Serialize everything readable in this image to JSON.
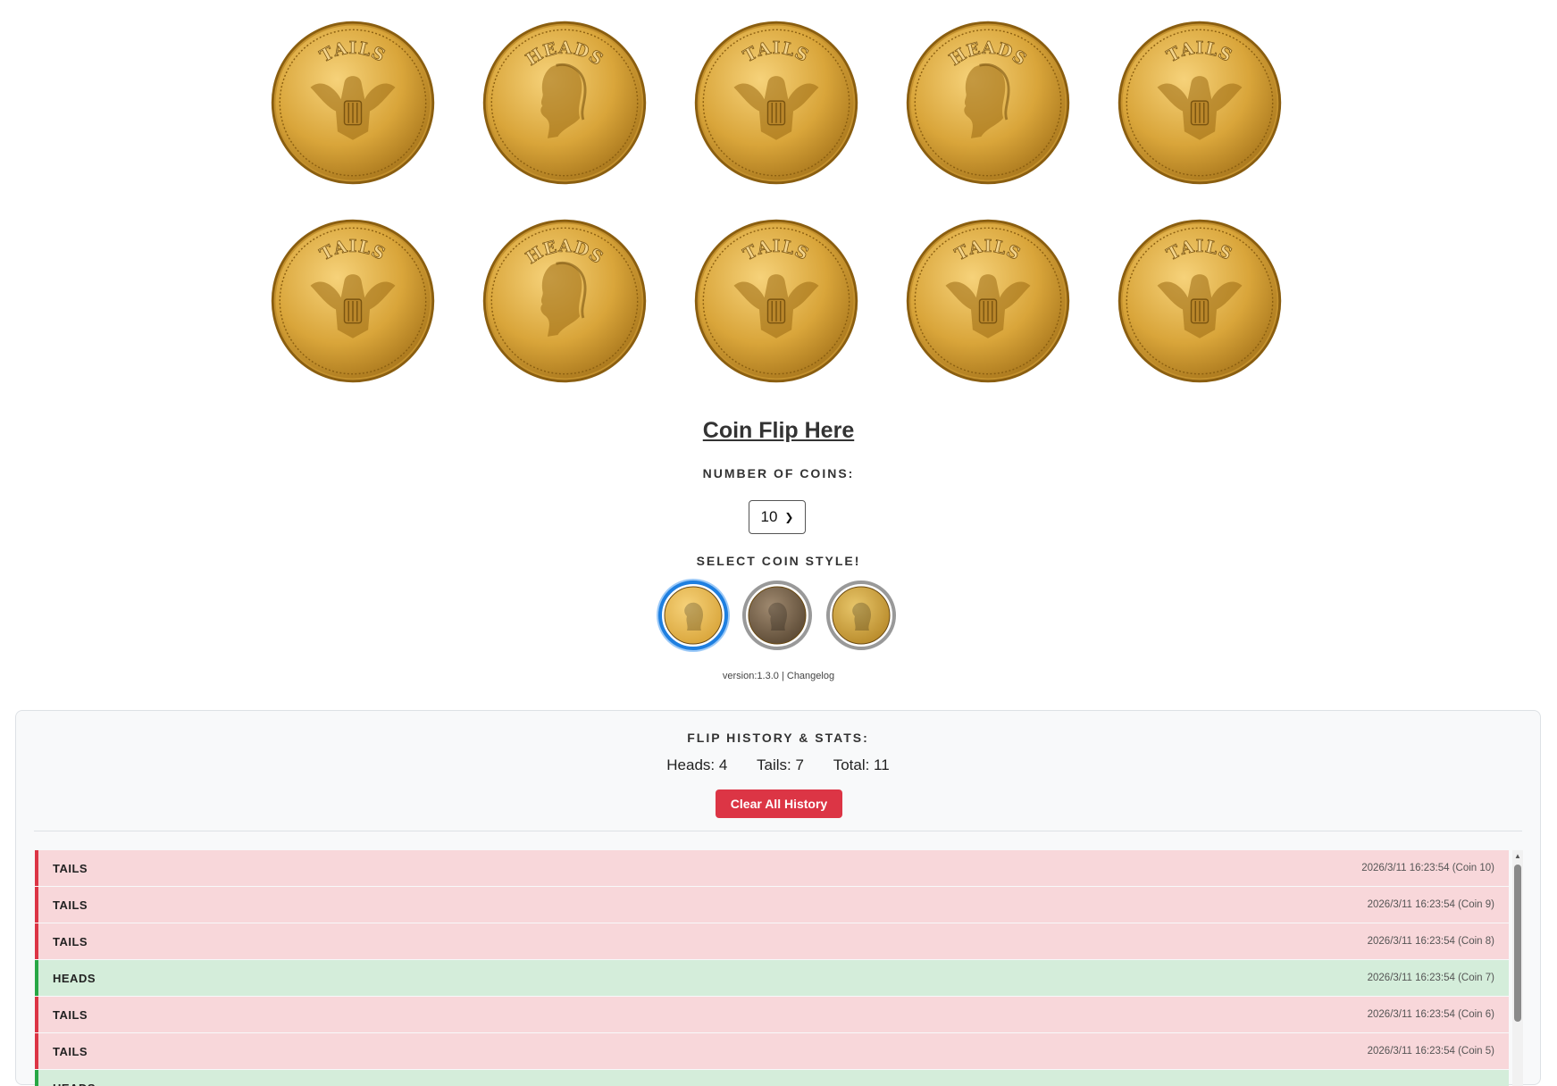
{
  "coins": [
    "tails",
    "heads",
    "tails",
    "heads",
    "tails",
    "tails",
    "heads",
    "tails",
    "tails",
    "tails"
  ],
  "coin_text": {
    "heads": "HEADS",
    "tails": "TAILS"
  },
  "title": "Coin Flip Here",
  "number_of_coins_label": "NUMBER OF COINS:",
  "number_of_coins_value": "10",
  "select_style_label": "SELECT COIN STYLE!",
  "coin_styles": [
    {
      "name": "gold",
      "selected": true
    },
    {
      "name": "bronze",
      "selected": false
    },
    {
      "name": "byzantine",
      "selected": false
    }
  ],
  "version_text": "version:1.3.0",
  "version_separator": " | ",
  "changelog_label": "Changelog",
  "history": {
    "title": "FLIP HISTORY & STATS:",
    "heads_label": "Heads: 4",
    "tails_label": "Tails: 7",
    "total_label": "Total: 11",
    "clear_label": "Clear All History",
    "rows": [
      {
        "result": "TAILS",
        "timestamp": "2026/3/11 16:23:54 (Coin 10)"
      },
      {
        "result": "TAILS",
        "timestamp": "2026/3/11 16:23:54 (Coin 9)"
      },
      {
        "result": "TAILS",
        "timestamp": "2026/3/11 16:23:54 (Coin 8)"
      },
      {
        "result": "HEADS",
        "timestamp": "2026/3/11 16:23:54 (Coin 7)"
      },
      {
        "result": "TAILS",
        "timestamp": "2026/3/11 16:23:54 (Coin 6)"
      },
      {
        "result": "TAILS",
        "timestamp": "2026/3/11 16:23:54 (Coin 5)"
      },
      {
        "result": "HEADS",
        "timestamp": ""
      }
    ]
  },
  "colors": {
    "gold": "#d9a53a",
    "gold_dark": "#9a6a12",
    "tails_bg": "#f8d7da",
    "tails_border": "#dc3545",
    "heads_bg": "#d4edda",
    "heads_border": "#28a745",
    "clear_button": "#dc3545",
    "selected_ring": "#1e7fe0"
  }
}
